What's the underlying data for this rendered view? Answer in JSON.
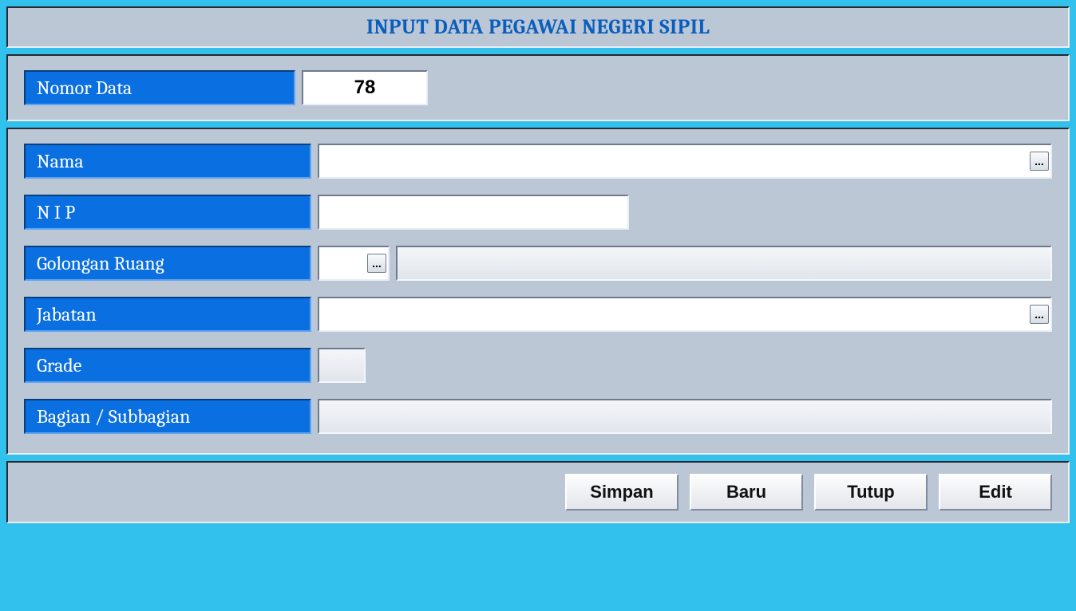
{
  "title": "INPUT DATA PEGAWAI NEGERI SIPIL",
  "top": {
    "nomor_data_label": "Nomor Data",
    "nomor_data_value": "78"
  },
  "fields": {
    "nama_label": "Nama",
    "nama_value": "",
    "nip_label": "N I P",
    "nip_value": "",
    "golongan_label": "Golongan Ruang",
    "golongan_code": "",
    "golongan_desc": "",
    "jabatan_label": "Jabatan",
    "jabatan_value": "",
    "grade_label": "Grade",
    "grade_value": "",
    "bagian_label": "Bagian / Subbagian",
    "bagian_value": ""
  },
  "buttons": {
    "simpan": "Simpan",
    "baru": "Baru",
    "tutup": "Tutup",
    "edit": "Edit"
  },
  "ellipsis": "..."
}
